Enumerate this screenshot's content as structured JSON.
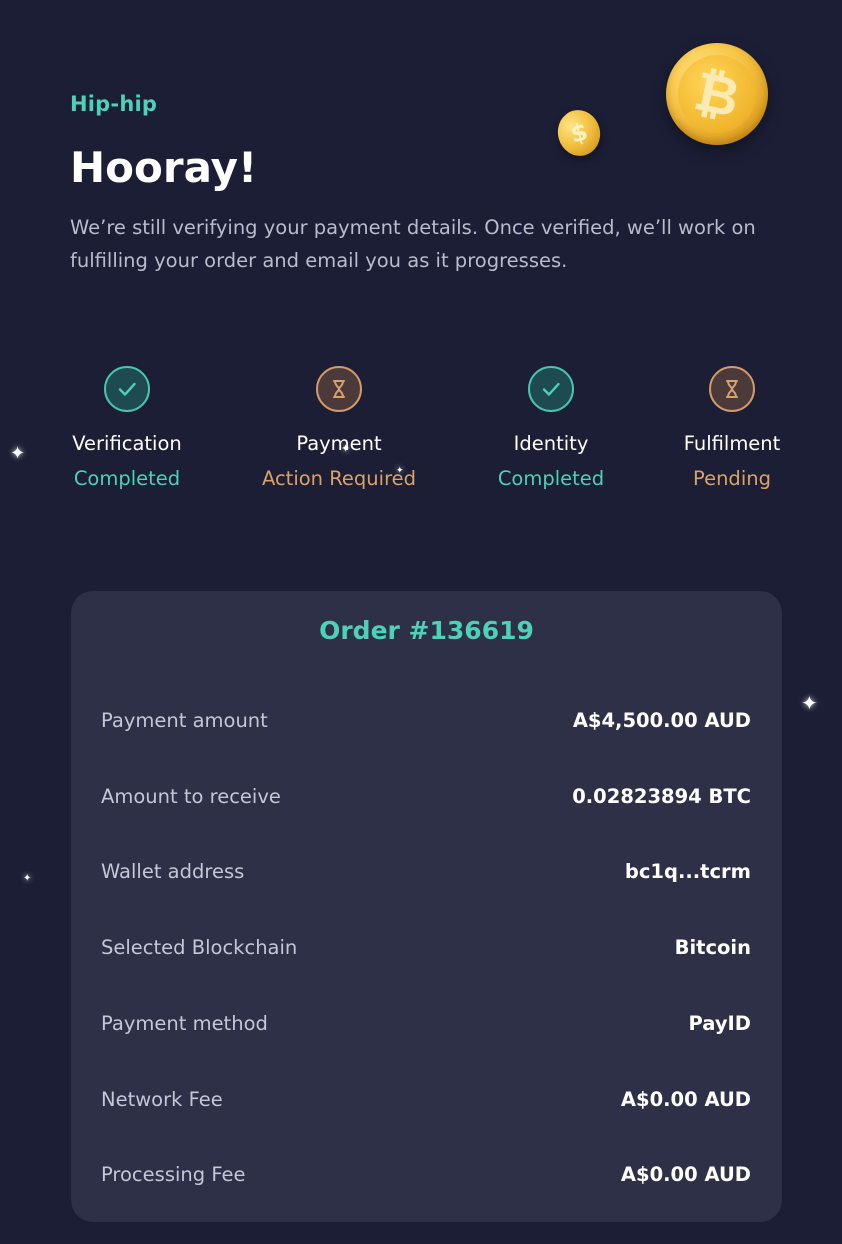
{
  "header": {
    "kicker": "Hip-hip",
    "title": "Hooray!",
    "description": "We’re still verifying your payment details. Once verified, we’ll work on fulfilling your order and email you as it progresses."
  },
  "decor": {
    "big_coin_icon": "bitcoin-coin-icon",
    "big_coin_glyph": "₿",
    "small_coin_icon": "dollar-coin-icon",
    "small_coin_glyph": "$"
  },
  "steps": [
    {
      "name": "Verification",
      "status": "Completed",
      "state": "done",
      "icon": "check-icon"
    },
    {
      "name": "Payment",
      "status": "Action Required",
      "state": "pending",
      "icon": "hourglass-icon"
    },
    {
      "name": "Identity",
      "status": "Completed",
      "state": "done",
      "icon": "check-icon"
    },
    {
      "name": "Fulfilment",
      "status": "Pending",
      "state": "pending",
      "icon": "hourglass-icon"
    }
  ],
  "order": {
    "title": "Order #136619",
    "rows": [
      {
        "label": "Payment amount",
        "value": "A$4,500.00 AUD"
      },
      {
        "label": "Amount to receive",
        "value": "0.02823894 BTC"
      },
      {
        "label": "Wallet address",
        "value": "bc1q...tcrm"
      },
      {
        "label": "Selected Blockchain",
        "value": "Bitcoin"
      },
      {
        "label": "Payment method",
        "value": "PayID"
      },
      {
        "label": "Network Fee",
        "value": "A$0.00 AUD"
      },
      {
        "label": "Processing Fee",
        "value": "A$0.00 AUD"
      }
    ]
  },
  "colors": {
    "background": "#1b1e35",
    "card": "#2d3046",
    "accent_green": "#4ed0b9",
    "accent_orange": "#d9a26b",
    "text_muted": "#b8bccd"
  }
}
